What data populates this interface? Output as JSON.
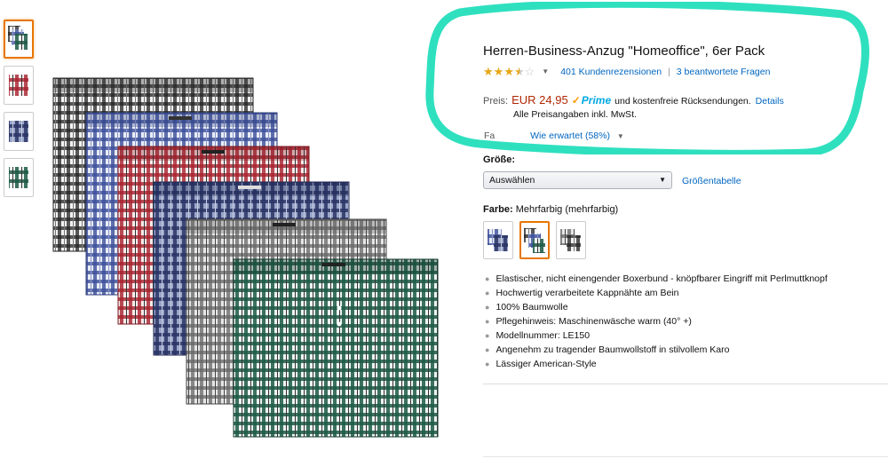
{
  "product": {
    "title": "Herren-Business-Anzug \"Homeoffice\", 6er Pack",
    "rating_stars": 3.5,
    "reviews_link": "401 Kundenrezensionen",
    "questions_link": "3 beantwortete Fragen",
    "price_label": "Preis:",
    "price": "EUR 24,95",
    "prime_label": "Prime",
    "returns_text": "und kostenfreie Rücksendungen.",
    "details_link": "Details",
    "vat_text": "Alle Preisangaben inkl. MwSt.",
    "partial_label": "Fa",
    "partial_link": "Wie erwartet (58%)"
  },
  "size": {
    "label": "Größe:",
    "selected": "Auswählen",
    "chart_link": "Größentabelle"
  },
  "color": {
    "label": "Farbe:",
    "value": "Mehrfarbig (mehrfarbig)"
  },
  "bullets": [
    "Elastischer, nicht einengender Boxerbund - knöpfbarer Eingriff mit Perlmuttknopf",
    "Hochwertig verarbeitete Kappnähte am Bein",
    "100% Baumwolle",
    "Pflegehinweis: Maschinenwäsche warm (40° +)",
    "Modellnummer: LE150",
    "Angenehm zu tragender Baumwollstoff in stilvollem Karo",
    "Lässiger American-Style"
  ],
  "colors": {
    "price": "#b12704",
    "link": "#0066c0",
    "prime": "#00a8e1",
    "star": "#e7a614",
    "highlight": "#2fe0bf",
    "selected_border": "#e77600"
  }
}
